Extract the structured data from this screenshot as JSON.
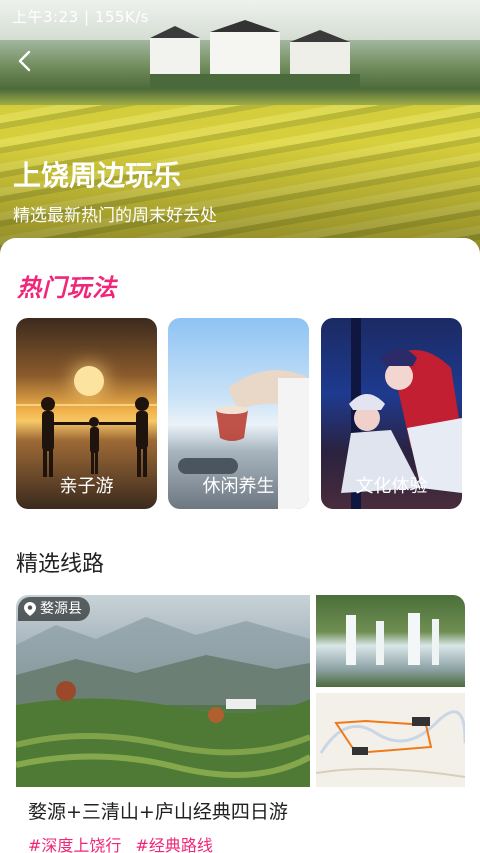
{
  "status_bar": {
    "text": "上午3:23 | 155K/s"
  },
  "hero": {
    "title": "上饶周边玩乐",
    "subtitle": "精选最新热门的周末好去处"
  },
  "hot": {
    "title": "热门玩法",
    "items": [
      {
        "label": "亲子游"
      },
      {
        "label": "休闲养生"
      },
      {
        "label": "文化体验"
      }
    ]
  },
  "routes": {
    "title": "精选线路",
    "cards": [
      {
        "location": "婺源县",
        "title": "婺源+三清山+庐山经典四日游",
        "tags": [
          "#深度上饶行",
          "#经典路线"
        ]
      }
    ]
  },
  "colors": {
    "accent": "#f0267a",
    "text": "#222222"
  }
}
